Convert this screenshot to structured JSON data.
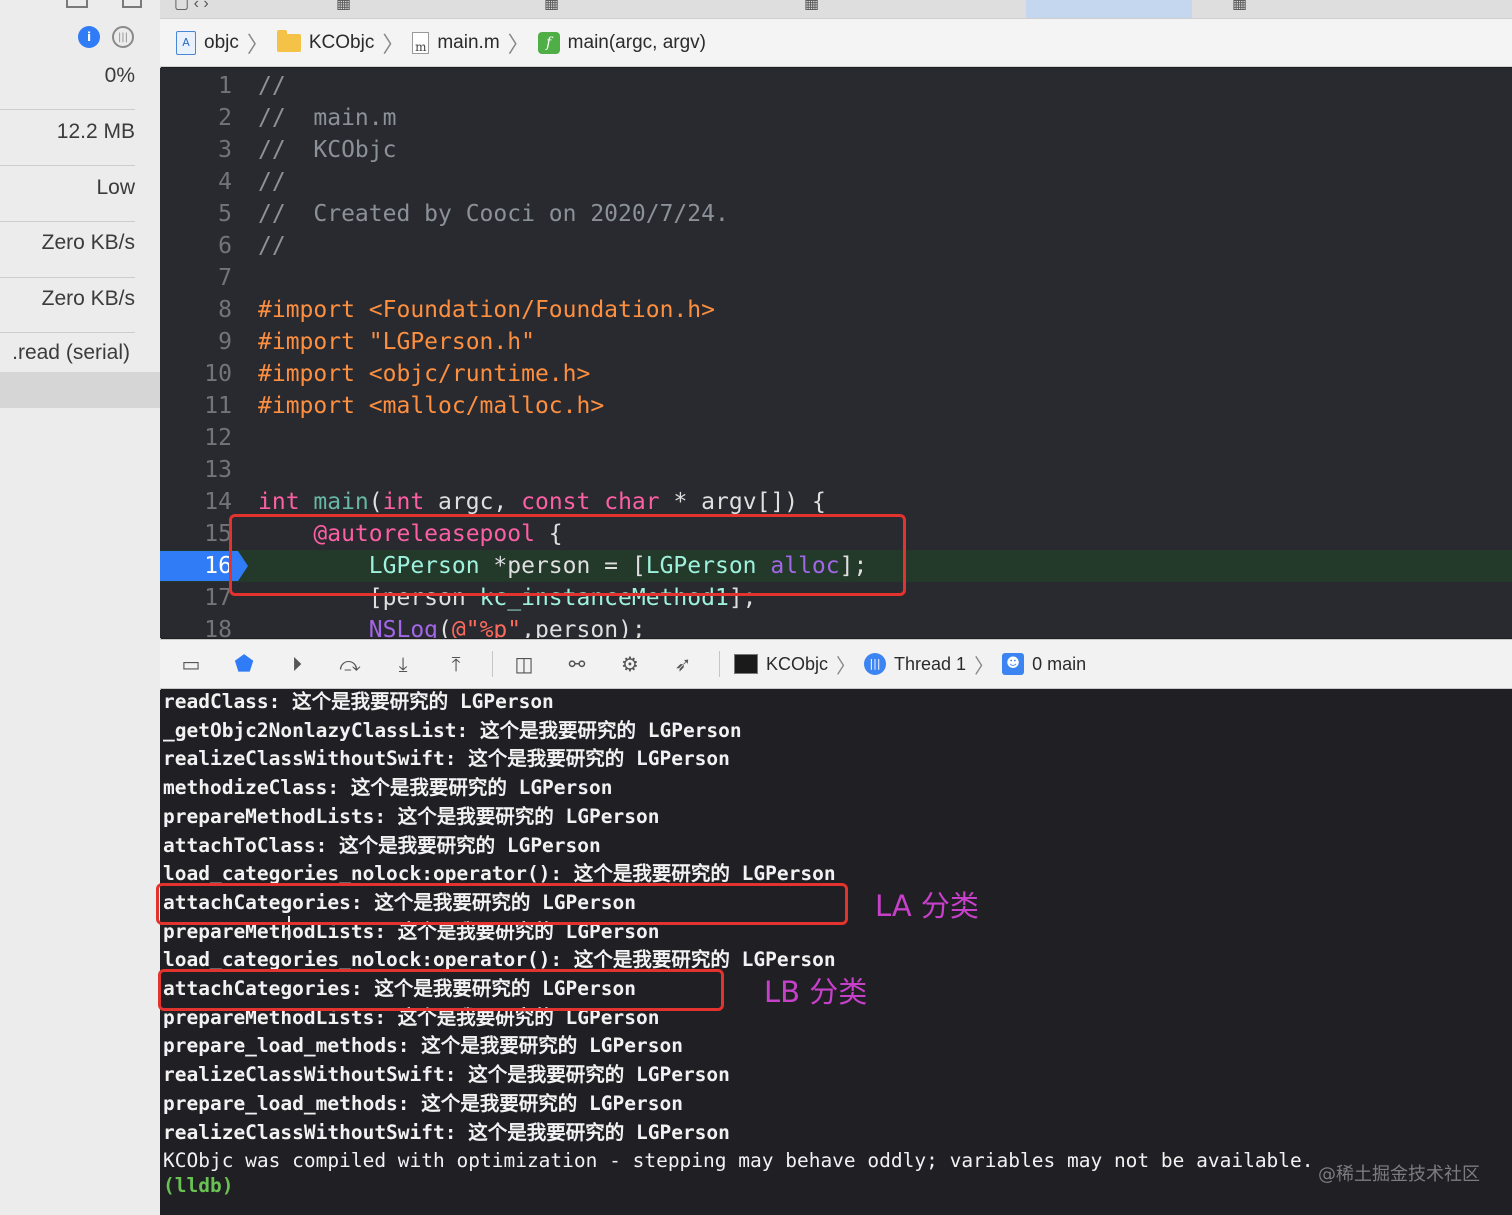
{
  "left_panel": {
    "gauges": [
      {
        "name": "cpu",
        "value": "0%"
      },
      {
        "name": "memory",
        "value": "12.2 MB"
      },
      {
        "name": "energy",
        "value": "Low"
      },
      {
        "name": "disk",
        "value": "Zero KB/s"
      },
      {
        "name": "network",
        "value": "Zero KB/s"
      }
    ],
    "thread_item": ".read (serial)"
  },
  "jump_bar": {
    "items": [
      "objc",
      "KCObjc",
      "main.m",
      "main(argc, argv)"
    ]
  },
  "editor": {
    "current_line": 16,
    "lines": [
      {
        "n": "1",
        "tokens": [
          {
            "t": "//",
            "c": "c-com"
          }
        ]
      },
      {
        "n": "2",
        "tokens": [
          {
            "t": "//  main.m",
            "c": "c-com"
          }
        ]
      },
      {
        "n": "3",
        "tokens": [
          {
            "t": "//  KCObjc",
            "c": "c-com"
          }
        ]
      },
      {
        "n": "4",
        "tokens": [
          {
            "t": "//",
            "c": "c-com"
          }
        ]
      },
      {
        "n": "5",
        "tokens": [
          {
            "t": "//  Created by Cooci on 2020/7/24.",
            "c": "c-com"
          }
        ]
      },
      {
        "n": "6",
        "tokens": [
          {
            "t": "//",
            "c": "c-com"
          }
        ]
      },
      {
        "n": "7",
        "tokens": []
      },
      {
        "n": "8",
        "tokens": [
          {
            "t": "#import ",
            "c": "c-pre"
          },
          {
            "t": "<Foundation/Foundation.h>",
            "c": "c-pre"
          }
        ]
      },
      {
        "n": "9",
        "tokens": [
          {
            "t": "#import ",
            "c": "c-pre"
          },
          {
            "t": "\"LGPerson.h\"",
            "c": "c-pre"
          }
        ]
      },
      {
        "n": "10",
        "tokens": [
          {
            "t": "#import ",
            "c": "c-pre"
          },
          {
            "t": "<objc/runtime.h>",
            "c": "c-pre"
          }
        ]
      },
      {
        "n": "11",
        "tokens": [
          {
            "t": "#import ",
            "c": "c-pre"
          },
          {
            "t": "<malloc/malloc.h>",
            "c": "c-pre"
          }
        ]
      },
      {
        "n": "12",
        "tokens": []
      },
      {
        "n": "13",
        "tokens": []
      },
      {
        "n": "14",
        "tokens": [
          {
            "t": "int ",
            "c": "c-kw"
          },
          {
            "t": "main",
            "c": "c-fn"
          },
          {
            "t": "(",
            "c": "c-txt"
          },
          {
            "t": "int",
            "c": "c-kw"
          },
          {
            "t": " argc, ",
            "c": "c-txt"
          },
          {
            "t": "const",
            "c": "c-kw"
          },
          {
            "t": " ",
            "c": "c-txt"
          },
          {
            "t": "char",
            "c": "c-kw"
          },
          {
            "t": " * argv[]) {",
            "c": "c-txt"
          }
        ]
      },
      {
        "n": "15",
        "tokens": [
          {
            "t": "    ",
            "c": "c-txt"
          },
          {
            "t": "@autoreleasepool",
            "c": "c-kw"
          },
          {
            "t": " {",
            "c": "c-txt"
          }
        ]
      },
      {
        "n": "16",
        "tokens": [
          {
            "t": "        ",
            "c": "c-txt"
          },
          {
            "t": "LGPerson",
            "c": "c-typ"
          },
          {
            "t": " *person = [",
            "c": "c-txt"
          },
          {
            "t": "LGPerson",
            "c": "c-typ"
          },
          {
            "t": " ",
            "c": "c-txt"
          },
          {
            "t": "alloc",
            "c": "c-cls"
          },
          {
            "t": "];",
            "c": "c-txt"
          }
        ]
      },
      {
        "n": "17",
        "tokens": [
          {
            "t": "        [person ",
            "c": "c-txt"
          },
          {
            "t": "kc_instanceMethod1",
            "c": "c-typ"
          },
          {
            "t": "];",
            "c": "c-txt"
          }
        ]
      },
      {
        "n": "18",
        "tokens": [
          {
            "t": "        ",
            "c": "c-txt"
          },
          {
            "t": "NSLog",
            "c": "c-cls"
          },
          {
            "t": "(",
            "c": "c-txt"
          },
          {
            "t": "@\"%p\"",
            "c": "c-str"
          },
          {
            "t": ",person);",
            "c": "c-txt"
          }
        ]
      }
    ]
  },
  "debug_bar": {
    "process": "KCObjc",
    "thread": "Thread 1",
    "frame": "0 main"
  },
  "console": {
    "lines": [
      "readClass: 这个是我要研究的 LGPerson",
      "_getObjc2NonlazyClassList: 这个是我要研究的 LGPerson",
      "realizeClassWithoutSwift: 这个是我要研究的 LGPerson",
      "methodizeClass: 这个是我要研究的 LGPerson",
      "prepareMethodLists: 这个是我要研究的 LGPerson",
      "attachToClass: 这个是我要研究的 LGPerson",
      "load_categories_nolock:operator(): 这个是我要研究的 LGPerson",
      "attachCategories: 这个是我要研究的 LGPerson",
      "prepareMethodLists: 这个是我要研究的 LGPerson",
      "load_categories_nolock:operator(): 这个是我要研究的 LGPerson",
      "attachCategories: 这个是我要研究的 LGPerson",
      "prepareMethodLists: 这个是我要研究的 LGPerson",
      "prepare_load_methods: 这个是我要研究的 LGPerson",
      "realizeClassWithoutSwift: 这个是我要研究的 LGPerson",
      "prepare_load_methods: 这个是我要研究的 LGPerson",
      "realizeClassWithoutSwift: 这个是我要研究的 LGPerson",
      "KCObjc was compiled with optimization - stepping may behave oddly; variables may not be available."
    ],
    "prompt": "(lldb)"
  },
  "annotations": {
    "la_label": "LA 分类",
    "lb_label": "LB 分类"
  },
  "watermark": "@稀土掘金技术社区",
  "colors": {
    "accent_blue": "#2f7cf6",
    "annotation_box": "#e3332e",
    "annotation_text": "#c640c9",
    "editor_bg": "#292a30",
    "console_bg": "#1f1f24"
  }
}
